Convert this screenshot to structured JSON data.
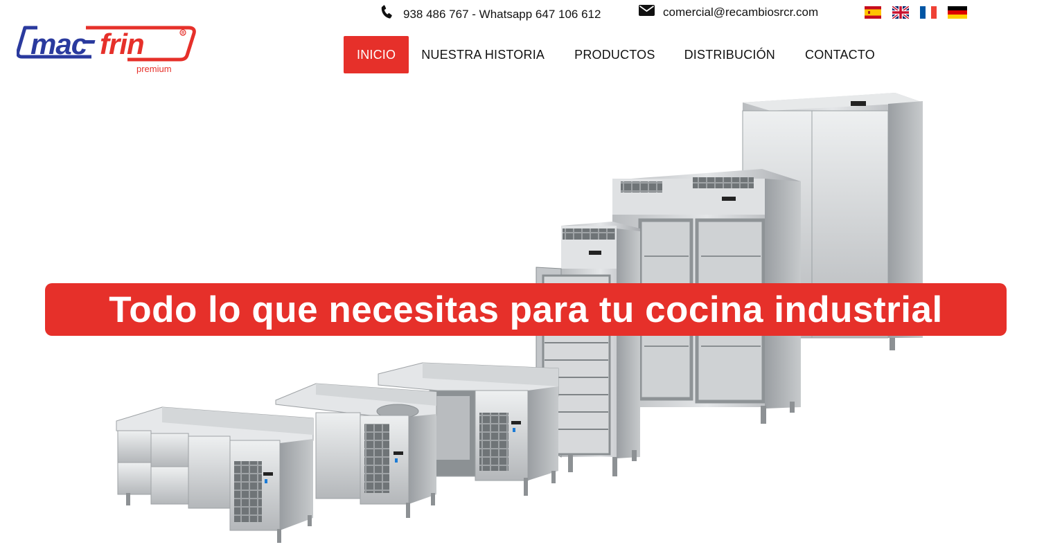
{
  "topbar": {
    "phone_icon": "phone-icon",
    "phone_text": "938 486 767 - Whatsapp 647 106 612",
    "mail_icon": "envelope-icon",
    "email_text": "comercial@recambiosrcr.com",
    "languages": [
      {
        "code": "es",
        "name": "Español"
      },
      {
        "code": "en",
        "name": "English"
      },
      {
        "code": "fr",
        "name": "Français"
      },
      {
        "code": "de",
        "name": "Deutsch"
      }
    ]
  },
  "logo": {
    "text": "mac-frin",
    "subtitle": "premium",
    "registered_mark": "R",
    "colors": {
      "red": "#e6302a",
      "blue": "#2a3a9e"
    }
  },
  "nav": {
    "items": [
      {
        "label": "INICIO",
        "active": true
      },
      {
        "label": "NUESTRA HISTORIA",
        "active": false
      },
      {
        "label": "PRODUCTOS",
        "active": false
      },
      {
        "label": "DISTRIBUCIÓN",
        "active": false
      },
      {
        "label": "CONTACTO",
        "active": false
      }
    ],
    "active_color": "#e6302a"
  },
  "hero": {
    "headline": "Todo lo que necesitas para tu cocina industrial",
    "banner_color": "#e6302a",
    "image_subject": "stainless steel refrigeration equipment"
  }
}
